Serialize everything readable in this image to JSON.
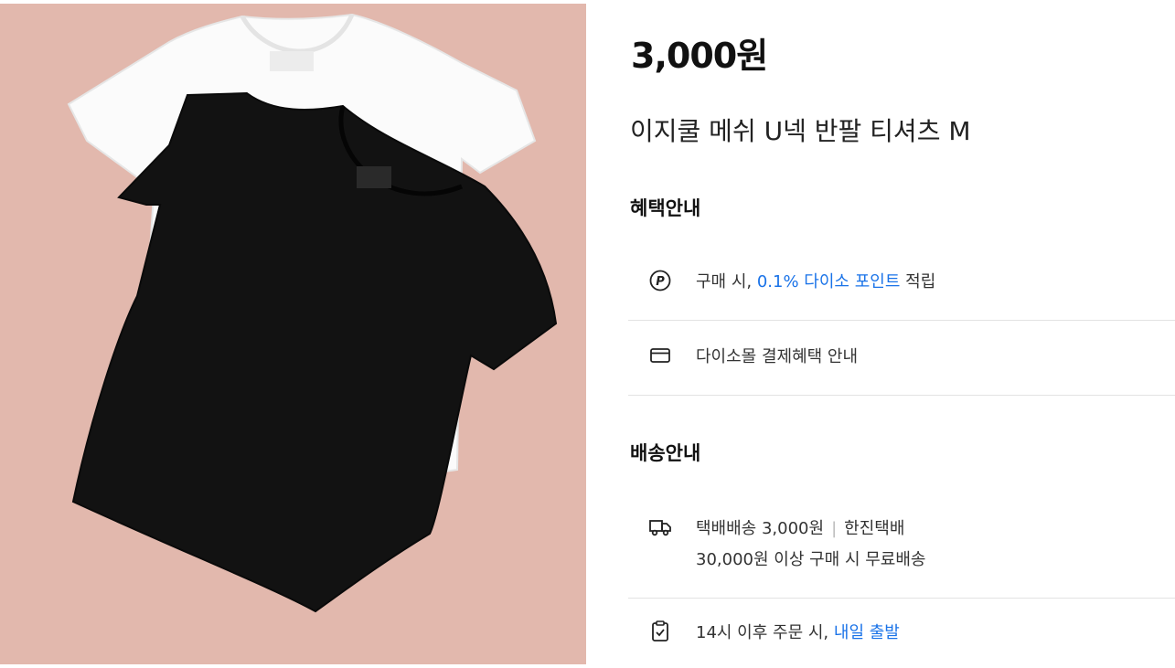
{
  "product": {
    "price": "3,000원",
    "title": "이지쿨 메쉬 U넥 반팔 티셔츠 M"
  },
  "benefits": {
    "heading": "혜택안내",
    "points": {
      "prefix": "구매 시,",
      "highlight": "0.1% 다이소 포인트",
      "suffix": "적립"
    },
    "payment": "다이소몰 결제혜택 안내"
  },
  "shipping": {
    "heading": "배송안내",
    "delivery_line1": "택배배송 3,000원",
    "separator": "|",
    "carrier": "한진택배",
    "delivery_line2": "30,000원 이상 구매 시 무료배송",
    "dispatch_prefix": "14시 이후 주문 시,",
    "dispatch_highlight": "내일 출발"
  },
  "icons": {
    "points": "point-p-icon",
    "payment": "card-icon",
    "truck": "truck-icon",
    "dispatch": "clipboard-check-icon"
  },
  "colors": {
    "photo_background": "#e2b8ad",
    "accent_blue": "#1a73e8"
  }
}
